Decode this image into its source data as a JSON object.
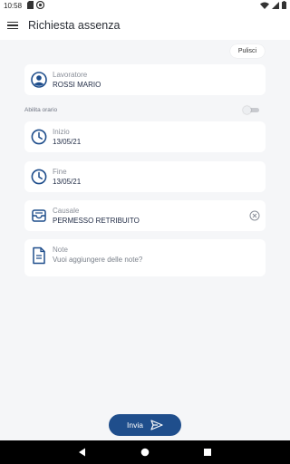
{
  "status_bar": {
    "time": "10:58"
  },
  "app_bar": {
    "title": "Richiesta assenza"
  },
  "clear_button": {
    "label": "Pulisci"
  },
  "worker": {
    "label": "Lavoratore",
    "value": "ROSSI MARIO"
  },
  "schedule_toggle": {
    "label": "Abilita orario",
    "enabled": false
  },
  "start": {
    "label": "Inizio",
    "value": "13/05/21"
  },
  "end": {
    "label": "Fine",
    "value": "13/05/21"
  },
  "cause": {
    "label": "Causale",
    "value": "PERMESSO RETRIBUITO"
  },
  "note": {
    "label": "Note",
    "placeholder": "Vuoi aggiungere delle note?"
  },
  "send_button": {
    "label": "Invia"
  },
  "colors": {
    "accent": "#1f4e8c",
    "background": "#f5f6f8",
    "card": "#ffffff"
  },
  "icons": [
    "menu-icon",
    "account-circle-icon",
    "clock-icon",
    "inbox-icon",
    "document-icon",
    "clear-circle-icon",
    "send-icon",
    "back-icon",
    "home-icon",
    "recents-icon"
  ]
}
